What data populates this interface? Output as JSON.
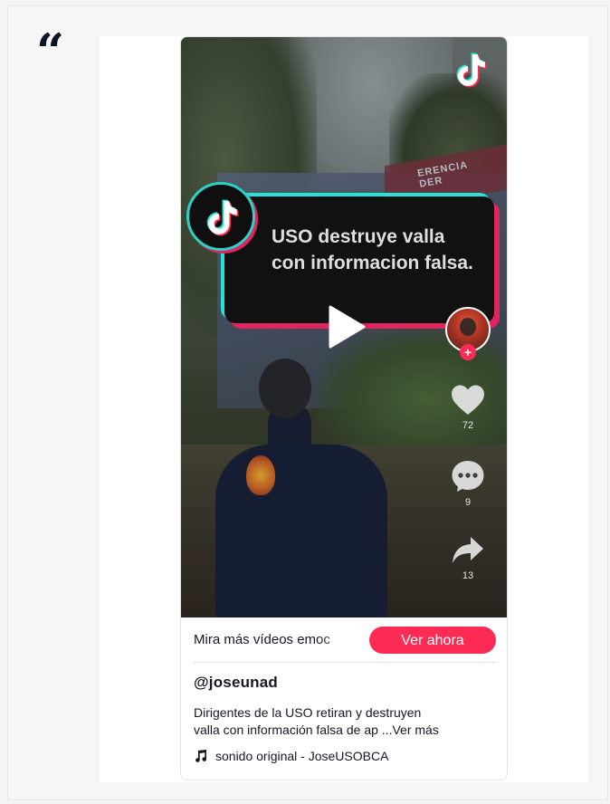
{
  "tiktok_embed": {
    "overlay_title": "USO destruye valla con informacion falsa.",
    "billboard_fragment": "ERENCIA\nDER",
    "likes_count": "72",
    "comments_count": "9",
    "shares_count": "13",
    "follow_symbol": "+",
    "cta_text": "Mira más vídeos emoc",
    "cta_button_label": "Ver ahora",
    "username": "@joseunad",
    "description_line1": "Dirigentes de la USO retiran y destruyen",
    "description_line2": "valla con información falsa de ap ...",
    "see_more_label": "Ver más",
    "sound_label": "sonido original - JoseUSOBCA"
  },
  "colors": {
    "accent": "#fe2c55",
    "tiktok_cyan": "#25e1d6",
    "tiktok_red": "#e0245e",
    "quote": "#0d1424"
  },
  "icons": [
    "quote-icon",
    "tiktok-logo-icon",
    "play-icon",
    "heart-icon",
    "comment-icon",
    "share-icon",
    "music-note-icon"
  ]
}
